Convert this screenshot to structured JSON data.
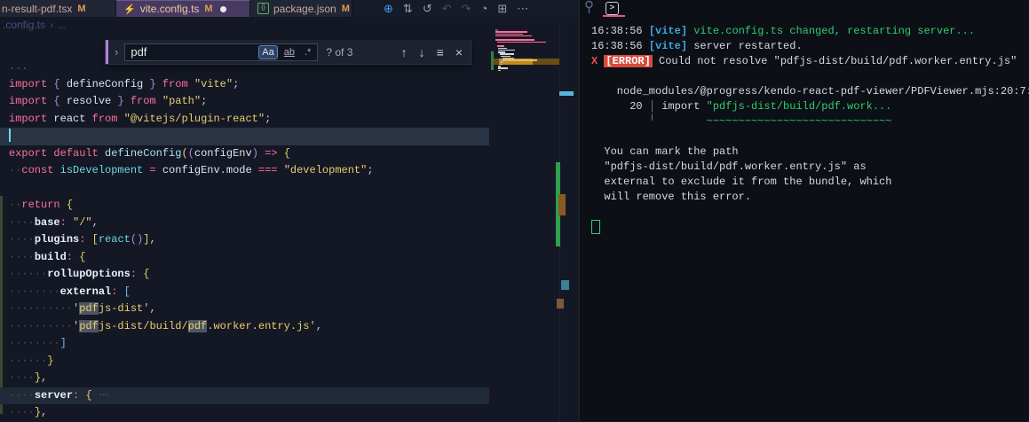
{
  "colors": {
    "keyword": "#ff6e9e",
    "string": "#e8cd6d",
    "variable": "#dde4ee",
    "function": "#a8e1f2",
    "cyan_ident": "#6ad8e2",
    "punct_purple": "#b488dd",
    "bracket_gold": "#e8cd6d",
    "bracket_blue": "#6fb8e8",
    "default_fg": "#c7ccd8",
    "fold_dim": "#4a6292",
    "property": "#eaf0f7",
    "ws_dots": "#4d5342",
    "match_bg": "#4d5663",
    "editor_bg": "#141824",
    "terminal_bg": "#0c0f15",
    "tabbar_bg": "#161b28",
    "tab_inactive_bg": "#202636",
    "tab_active_bg": "#473a60",
    "tab_label": "#efc6a4",
    "badge_m": "#e09a57",
    "find_accent": "#b57ee0",
    "cursor": "#66d9f2",
    "current_line": "#2b3444",
    "term_green": "#2ecc71",
    "term_cyan": "#3fa7e3",
    "term_red": "#f14c4c",
    "error_badge_bg": "#d84a3d",
    "term_fg": "#d6d9de",
    "pink_underline": "#e0519e",
    "vite_bolt": "#f6b83c",
    "pkg_green": "#6abf6a",
    "breadcrumb": "#3e5180",
    "blue_icon": "#3f9cf5",
    "gray_icon": "#96a0b0"
  },
  "tabs": [
    {
      "label": "n-result-pdf.tsx",
      "badge": "M"
    },
    {
      "label": "vite.config.ts",
      "badge": "M",
      "icon_glyph": "⚡",
      "dirty": true
    },
    {
      "label": "package.json",
      "badge": "M",
      "icon_glyph": "{}"
    }
  ],
  "editor_actions": [
    {
      "glyph": "⊕",
      "name": "blue-extension-icon"
    },
    {
      "glyph": "⇅",
      "name": "source-control-compare-icon"
    },
    {
      "glyph": "↺",
      "name": "discard-changes-icon"
    },
    {
      "glyph": "↶",
      "name": "nav-back-icon"
    },
    {
      "glyph": "↷",
      "name": "nav-forward-icon"
    },
    {
      "glyph": "◔",
      "name": "run-profile-icon"
    },
    {
      "glyph": "⊞",
      "name": "split-editor-icon"
    },
    {
      "glyph": "⋯",
      "name": "more-actions-icon"
    }
  ],
  "breadcrumb": {
    "file": ".config.ts",
    "sep": "›",
    "tail": "..."
  },
  "find": {
    "chevron": "›",
    "query": "pdf",
    "match_case": "Aa",
    "whole_word": "ab",
    "regex": ".*",
    "results": "? of 3",
    "prev": "↑",
    "next": "↓",
    "in_selection": "≡",
    "close": "×"
  },
  "code": {
    "lines": [
      {
        "t": [
          [
            "fold",
            "..."
          ]
        ]
      },
      {
        "t": [
          [
            "kw",
            "import"
          ],
          [
            "fg",
            " "
          ],
          [
            "pp",
            "{"
          ],
          [
            "fg",
            " "
          ],
          [
            "var",
            "defineConfig"
          ],
          [
            "fg",
            " "
          ],
          [
            "pp",
            "}"
          ],
          [
            "fg",
            " "
          ],
          [
            "kw",
            "from"
          ],
          [
            "fg",
            " "
          ],
          [
            "str",
            "\"vite\""
          ],
          [
            "fg",
            ";"
          ]
        ]
      },
      {
        "t": [
          [
            "kw",
            "import"
          ],
          [
            "fg",
            " "
          ],
          [
            "pp",
            "{"
          ],
          [
            "fg",
            " "
          ],
          [
            "var",
            "resolve"
          ],
          [
            "fg",
            " "
          ],
          [
            "pp",
            "}"
          ],
          [
            "fg",
            " "
          ],
          [
            "kw",
            "from"
          ],
          [
            "fg",
            " "
          ],
          [
            "str",
            "\"path\""
          ],
          [
            "fg",
            ";"
          ]
        ]
      },
      {
        "t": [
          [
            "kw",
            "import"
          ],
          [
            "fg",
            " "
          ],
          [
            "var",
            "react"
          ],
          [
            "fg",
            " "
          ],
          [
            "kw",
            "from"
          ],
          [
            "fg",
            " "
          ],
          [
            "str",
            "\"@vitejs/plugin-react\""
          ],
          [
            "fg",
            ";"
          ]
        ]
      },
      {
        "cls": "cur",
        "cursor": true,
        "t": []
      },
      {
        "t": [
          [
            "kw",
            "export"
          ],
          [
            "fg",
            " "
          ],
          [
            "kw",
            "default"
          ],
          [
            "fg",
            " "
          ],
          [
            "fn",
            "defineConfig"
          ],
          [
            "b1",
            "("
          ],
          [
            "pp",
            "("
          ],
          [
            "var",
            "configEnv"
          ],
          [
            "pp",
            ")"
          ],
          [
            "fg",
            " "
          ],
          [
            "kw",
            "=>"
          ],
          [
            "fg",
            " "
          ],
          [
            "b1",
            "{"
          ]
        ]
      },
      {
        "t": [
          [
            "ws",
            2
          ],
          [
            "kw",
            "const"
          ],
          [
            "fg",
            " "
          ],
          [
            "cy",
            "isDevelopment"
          ],
          [
            "fg",
            " "
          ],
          [
            "kw",
            "="
          ],
          [
            "fg",
            " "
          ],
          [
            "var",
            "configEnv"
          ],
          [
            "fg",
            "."
          ],
          [
            "var",
            "mode"
          ],
          [
            "fg",
            " "
          ],
          [
            "kw",
            "==="
          ],
          [
            "fg",
            " "
          ],
          [
            "str",
            "\"development\""
          ],
          [
            "fg",
            ";"
          ]
        ]
      },
      {
        "t": []
      },
      {
        "t": [
          [
            "ws",
            2
          ],
          [
            "kw",
            "return"
          ],
          [
            "fg",
            " "
          ],
          [
            "b1",
            "{"
          ]
        ]
      },
      {
        "t": [
          [
            "ws",
            4
          ],
          [
            "prop",
            "base"
          ],
          [
            "kw",
            ":"
          ],
          [
            "fg",
            " "
          ],
          [
            "str",
            "\"/\""
          ],
          [
            "fg",
            ","
          ]
        ]
      },
      {
        "t": [
          [
            "ws",
            4
          ],
          [
            "prop",
            "plugins"
          ],
          [
            "kw",
            ":"
          ],
          [
            "fg",
            " "
          ],
          [
            "b1",
            "["
          ],
          [
            "cy",
            "react"
          ],
          [
            "pp",
            "()"
          ],
          [
            "b1",
            "]"
          ],
          [
            "fg",
            ","
          ]
        ]
      },
      {
        "t": [
          [
            "ws",
            4
          ],
          [
            "prop",
            "build"
          ],
          [
            "kw",
            ":"
          ],
          [
            "fg",
            " "
          ],
          [
            "b1",
            "{"
          ]
        ]
      },
      {
        "t": [
          [
            "ws",
            6
          ],
          [
            "prop",
            "rollupOptions"
          ],
          [
            "kw",
            ":"
          ],
          [
            "fg",
            " "
          ],
          [
            "b1",
            "{"
          ]
        ]
      },
      {
        "t": [
          [
            "ws",
            8
          ],
          [
            "prop",
            "external"
          ],
          [
            "kw",
            ":"
          ],
          [
            "fg",
            " "
          ],
          [
            "b2",
            "["
          ]
        ]
      },
      {
        "t": [
          [
            "ws",
            10
          ],
          [
            "str",
            "'"
          ],
          [
            "strm",
            "pdf"
          ],
          [
            "str",
            "js-dist'"
          ],
          [
            "fg",
            ","
          ]
        ]
      },
      {
        "t": [
          [
            "ws",
            10
          ],
          [
            "str",
            "'"
          ],
          [
            "strm",
            "pdf"
          ],
          [
            "str",
            "js-dist/build/"
          ],
          [
            "strm",
            "pdf"
          ],
          [
            "str",
            ".worker.entry.js'"
          ],
          [
            "fg",
            ","
          ]
        ]
      },
      {
        "t": [
          [
            "ws",
            8
          ],
          [
            "b2",
            "]"
          ]
        ]
      },
      {
        "t": [
          [
            "ws",
            6
          ],
          [
            "b1",
            "}"
          ]
        ]
      },
      {
        "t": [
          [
            "ws",
            4
          ],
          [
            "b1",
            "}"
          ],
          [
            "fg",
            ","
          ]
        ]
      },
      {
        "cls": "fold",
        "t": [
          [
            "ws",
            4
          ],
          [
            "prop",
            "server"
          ],
          [
            "kw",
            ":"
          ],
          [
            "fg",
            " "
          ],
          [
            "b1",
            "{"
          ],
          [
            "fg",
            " "
          ],
          [
            "fold",
            "⋯"
          ]
        ]
      },
      {
        "t": [
          [
            "ws",
            4
          ],
          [
            "b1",
            "}"
          ],
          [
            "fg",
            ","
          ]
        ]
      }
    ]
  },
  "terminal": {
    "tab_glyph": ">",
    "lines": [
      {
        "t": [
          [
            "fg",
            "16:38:56 "
          ],
          [
            "cyan",
            "[vite]"
          ],
          [
            "fg",
            " "
          ],
          [
            "green",
            "vite.config.ts changed, restarting server..."
          ]
        ]
      },
      {
        "t": [
          [
            "fg",
            "16:38:56 "
          ],
          [
            "cyan",
            "[vite]"
          ],
          [
            "fg",
            " "
          ],
          [
            "fg",
            "server restarted."
          ]
        ]
      },
      {
        "t": [
          [
            "red",
            "X "
          ],
          [
            "errb",
            "[ERROR]"
          ],
          [
            "fg",
            " Could not resolve \"pdfjs-dist/build/pdf.worker.entry.js\""
          ]
        ]
      },
      {
        "t": []
      },
      {
        "t": [
          [
            "fg",
            "    node_modules/@progress/kendo-react-pdf-viewer/PDFViewer.mjs:20:7:"
          ]
        ]
      },
      {
        "t": [
          [
            "fg",
            "      20 "
          ],
          [
            "dim",
            "│"
          ],
          [
            "fg",
            " import "
          ],
          [
            "green",
            "\"pdfjs-dist/build/pdf.work..."
          ]
        ]
      },
      {
        "t": [
          [
            "fg",
            "         "
          ],
          [
            "dim",
            "╵"
          ],
          [
            "fg",
            "        "
          ],
          [
            "green",
            "~~~~~~~~~~~~~~~~~~~~~~~~~~~~~"
          ]
        ]
      },
      {
        "t": []
      },
      {
        "t": [
          [
            "fg",
            "  You can mark the path"
          ]
        ]
      },
      {
        "t": [
          [
            "fg",
            "  \"pdfjs-dist/build/pdf.worker.entry.js\" as"
          ]
        ]
      },
      {
        "t": [
          [
            "fg",
            "  external to exclude it from the bundle, which"
          ]
        ]
      },
      {
        "t": [
          [
            "fg",
            "  will remove this error."
          ]
        ]
      },
      {
        "t": []
      },
      {
        "cursorBlock": true
      }
    ]
  }
}
